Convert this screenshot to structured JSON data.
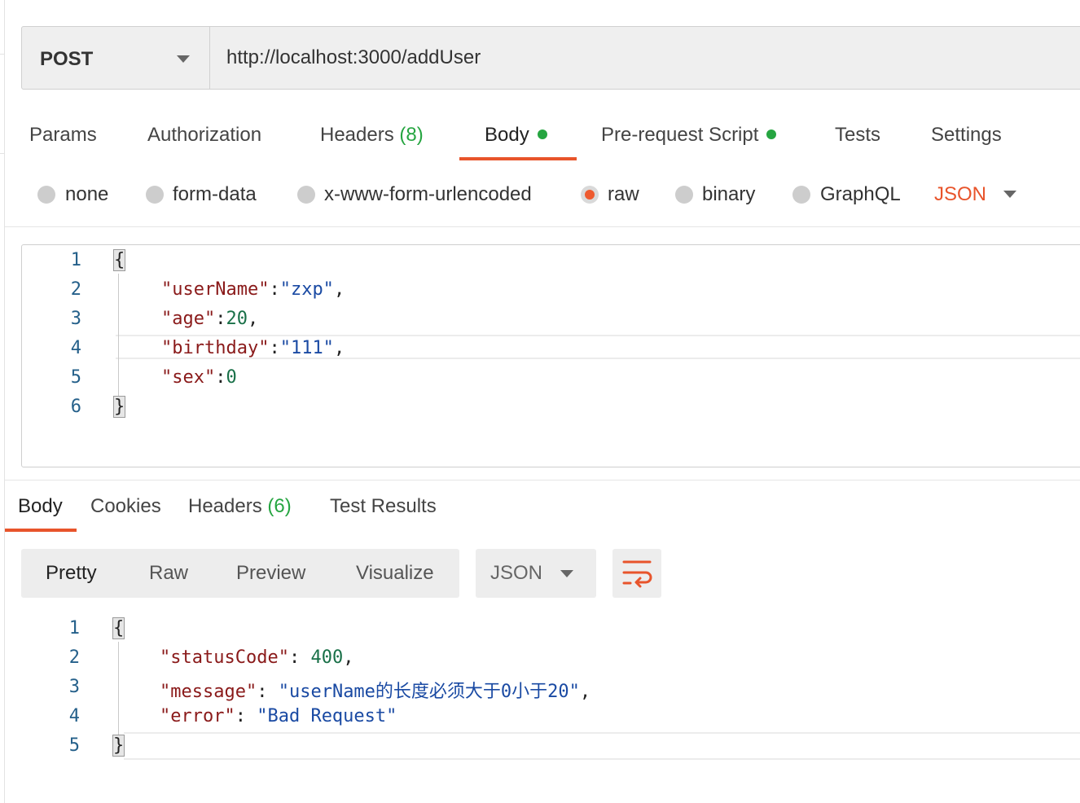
{
  "request": {
    "method": "POST",
    "url": "http://localhost:3000/addUser"
  },
  "request_tabs": {
    "params": "Params",
    "authorization": "Authorization",
    "headers": "Headers",
    "headers_count": "(8)",
    "body": "Body",
    "prerequest": "Pre-request Script",
    "tests": "Tests",
    "settings": "Settings"
  },
  "body_types": {
    "none": "none",
    "form_data": "form-data",
    "urlencoded": "x-www-form-urlencoded",
    "raw": "raw",
    "binary": "binary",
    "graphql": "GraphQL",
    "format": "JSON",
    "selected": "raw"
  },
  "request_body": {
    "line_numbers": [
      "1",
      "2",
      "3",
      "4",
      "5",
      "6"
    ],
    "open": "{",
    "close": "}",
    "username_key": "\"userName\"",
    "username_val": "\"zxp\"",
    "age_key": "\"age\"",
    "age_val": "20",
    "birthday_key": "\"birthday\"",
    "birthday_val": "\"111\"",
    "sex_key": "\"sex\"",
    "sex_val": "0"
  },
  "response_tabs": {
    "body": "Body",
    "cookies": "Cookies",
    "headers": "Headers",
    "headers_count": "(6)",
    "test_results": "Test Results"
  },
  "view_modes": {
    "pretty": "Pretty",
    "raw": "Raw",
    "preview": "Preview",
    "visualize": "Visualize",
    "format": "JSON"
  },
  "response_body": {
    "line_numbers": [
      "1",
      "2",
      "3",
      "4",
      "5"
    ],
    "open": "{",
    "close": "}",
    "status_key": "\"statusCode\"",
    "status_val": "400",
    "message_key": "\"message\"",
    "message_val": "\"userName的长度必须大于0小于20\"",
    "error_key": "\"error\"",
    "error_val": "\"Bad Request\""
  },
  "colors": {
    "accent": "#e8542b",
    "green_indicator": "#26a541",
    "json_key": "#8a1a1a",
    "json_string": "#1a4aa3",
    "json_number": "#197048"
  },
  "icons": [
    "method-dropdown-icon",
    "format-dropdown-icon",
    "wrap-lines-icon"
  ]
}
